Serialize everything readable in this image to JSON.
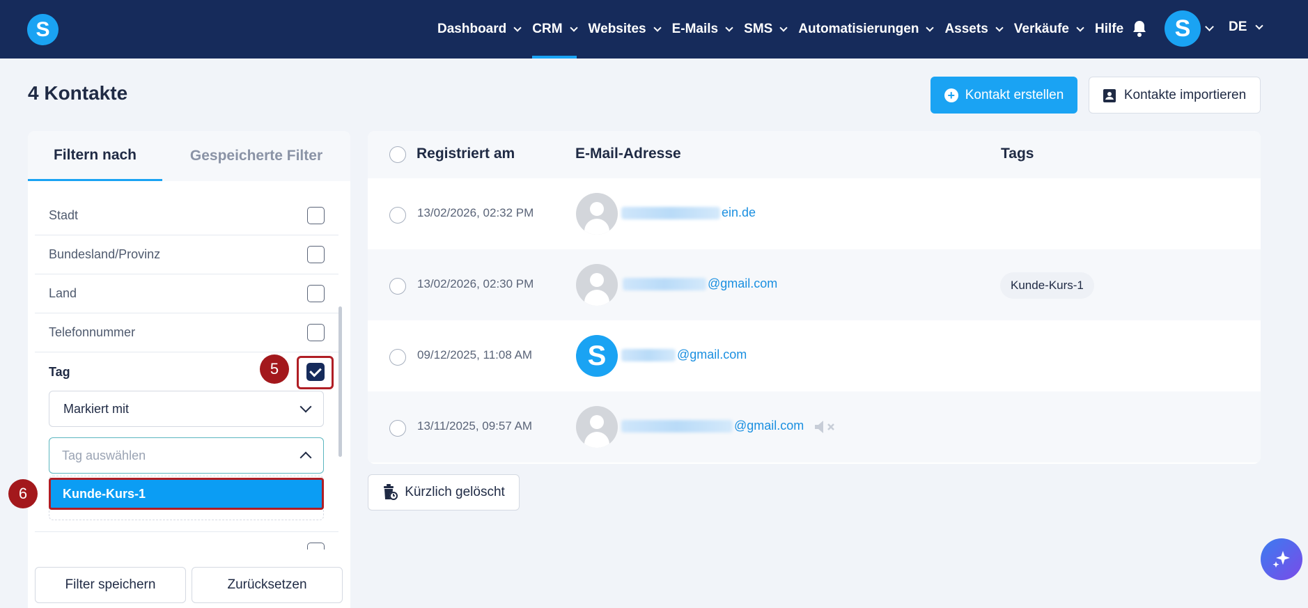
{
  "nav": {
    "logo": "S",
    "items": [
      {
        "label": "Dashboard",
        "has_menu": true,
        "active": false
      },
      {
        "label": "CRM",
        "has_menu": true,
        "active": true
      },
      {
        "label": "Websites",
        "has_menu": true,
        "active": false
      },
      {
        "label": "E-Mails",
        "has_menu": true,
        "active": false
      },
      {
        "label": "SMS",
        "has_menu": true,
        "active": false
      },
      {
        "label": "Automatisierungen",
        "has_menu": true,
        "active": false
      },
      {
        "label": "Assets",
        "has_menu": true,
        "active": false
      },
      {
        "label": "Verkäufe",
        "has_menu": true,
        "active": false
      },
      {
        "label": "Hilfe",
        "has_menu": false,
        "active": false
      }
    ],
    "avatar": "S",
    "language": "DE",
    "accent_color": "#1aa3f3",
    "bg_color": "#162b5b"
  },
  "header": {
    "title": "4 Kontakte",
    "create_button": "Kontakt erstellen",
    "import_button": "Kontakte importieren"
  },
  "filter_panel": {
    "tabs": {
      "filter": "Filtern nach",
      "saved": "Gespeicherte Filter"
    },
    "rows": [
      {
        "label": "Stadt",
        "checked": false
      },
      {
        "label": "Bundesland/Provinz",
        "checked": false
      },
      {
        "label": "Land",
        "checked": false
      },
      {
        "label": "Telefonnummer",
        "checked": false
      }
    ],
    "tag": {
      "label": "Tag",
      "checked": true,
      "condition": "Markiert mit",
      "input_placeholder": "Tag auswählen",
      "options": [
        "Kunde-Kurs-1"
      ]
    },
    "save_button": "Filter speichern",
    "reset_button": "Zurücksetzen"
  },
  "annotations": {
    "step5": "5",
    "step6": "6",
    "highlight_color": "#b01e25"
  },
  "table": {
    "columns": {
      "registered": "Registriert am",
      "email": "E-Mail-Adresse",
      "tags": "Tags"
    },
    "rows": [
      {
        "date": "13/02/2026, 02:32 PM",
        "email_suffix": "ein.de",
        "avatar": "default",
        "tags": [],
        "muted": false
      },
      {
        "date": "13/02/2026, 02:30 PM",
        "email_suffix": "@gmail.com",
        "avatar": "default",
        "tags": [
          "Kunde-Kurs-1"
        ],
        "muted": false
      },
      {
        "date": "09/12/2025, 11:08 AM",
        "email_suffix": "@gmail.com",
        "avatar": "brand",
        "tags": [],
        "muted": false
      },
      {
        "date": "13/11/2025, 09:57 AM",
        "email_suffix": "@gmail.com",
        "avatar": "default",
        "tags": [],
        "muted": true
      }
    ]
  },
  "recently_deleted_button": "Kürzlich gelöscht"
}
